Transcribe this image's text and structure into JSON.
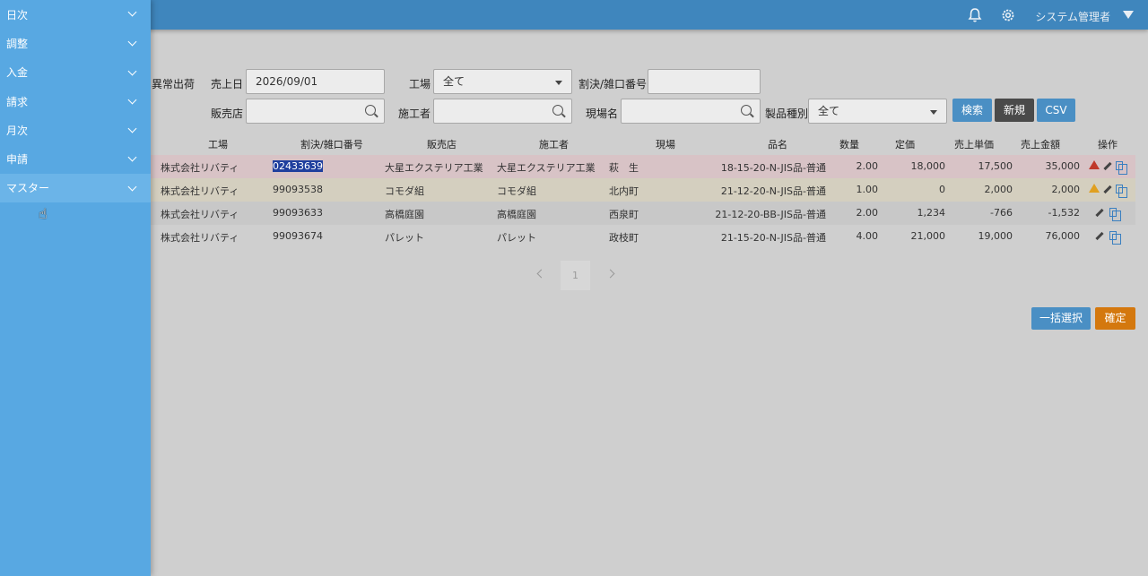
{
  "header": {
    "user_name": "システム管理者",
    "icons": [
      "bell-icon",
      "gear-icon"
    ]
  },
  "sidebar": {
    "items": [
      {
        "label": "日次"
      },
      {
        "label": "調整"
      },
      {
        "label": "入金"
      },
      {
        "label": "請求"
      },
      {
        "label": "月次"
      },
      {
        "label": "申請"
      },
      {
        "label": "マスター"
      }
    ]
  },
  "filters": {
    "abnormal_label": "異常出荷",
    "sales_date_label": "売上日",
    "sales_date_value": "2026/09/01",
    "factory_label": "工場",
    "factory_value": "全て",
    "slip_label": "割決/雑口番号",
    "slip_value": "",
    "store_label": "販売店",
    "store_value": "",
    "builder_label": "施工者",
    "builder_value": "",
    "site_label": "現場名",
    "site_value": "",
    "product_type_label": "製品種別",
    "product_type_value": "全て"
  },
  "buttons": {
    "search": "検索",
    "new": "新規",
    "csv": "CSV",
    "select_all": "一括選択",
    "confirm": "確定"
  },
  "table": {
    "headers": [
      "工場",
      "割決/雑口番号",
      "販売店",
      "施工者",
      "現場",
      "品名",
      "数量",
      "定価",
      "売上単価",
      "売上金額",
      "操作"
    ],
    "rows": [
      {
        "factory": "株式会社リバティ",
        "slip": "02433639",
        "store": "大星エクステリア工業",
        "builder": "大星エクステリア工業",
        "site": "萩　生",
        "product": "18-15-20-N-JIS品-普通",
        "qty": "2.00",
        "list_price": "18,000",
        "unit_price": "17,500",
        "amount": "35,000",
        "status": "error",
        "bg": "#d8c3c6"
      },
      {
        "factory": "株式会社リバティ",
        "slip": "99093538",
        "store": "コモダ組",
        "builder": "コモダ組",
        "site": "北内町",
        "product": "21-12-20-N-JIS品-普通",
        "qty": "1.00",
        "list_price": "0",
        "unit_price": "2,000",
        "amount": "2,000",
        "status": "warning",
        "bg": "#d4cfbf"
      },
      {
        "factory": "株式会社リバティ",
        "slip": "99093633",
        "store": "高橋庭園",
        "builder": "高橋庭園",
        "site": "西泉町",
        "product": "21-12-20-BB-JIS品-普通",
        "qty": "2.00",
        "list_price": "1,234",
        "unit_price": "-766",
        "amount": "-1,532",
        "status": "none",
        "bg": "#c8c8c8"
      },
      {
        "factory": "株式会社リバティ",
        "slip": "99093674",
        "store": "パレット",
        "builder": "パレット",
        "site": "政枝町",
        "product": "21-15-20-N-JIS品-普通",
        "qty": "4.00",
        "list_price": "21,000",
        "unit_price": "19,000",
        "amount": "76,000",
        "status": "none",
        "bg": "#cfcfcf"
      }
    ]
  },
  "pagination": {
    "current_page": "1"
  },
  "colors": {
    "header_bg": "#3f86bd",
    "sidebar_bg": "#58a8e2",
    "error": "#c0392b",
    "warning": "#e0a020"
  }
}
